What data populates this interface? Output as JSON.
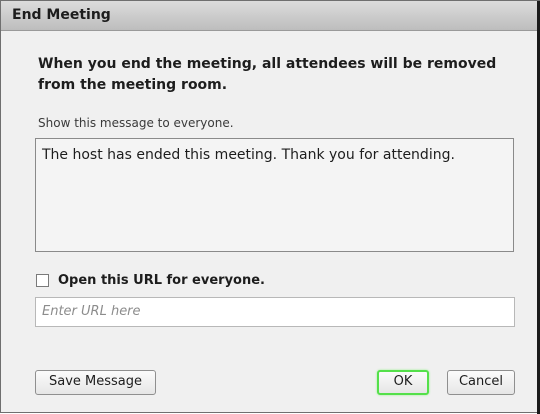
{
  "dialog": {
    "title": "End Meeting",
    "heading": "When you end the meeting, all attendees will be removed from the meeting room.",
    "message_label": "Show this message to everyone.",
    "message_value": "The host has ended this meeting. Thank you for attending.",
    "url_checkbox_label": "Open this URL for everyone.",
    "url_checkbox_checked": false,
    "url_placeholder": "Enter URL here",
    "buttons": {
      "save": "Save Message",
      "ok": "OK",
      "cancel": "Cancel"
    },
    "accent_color": "#54e04a"
  }
}
